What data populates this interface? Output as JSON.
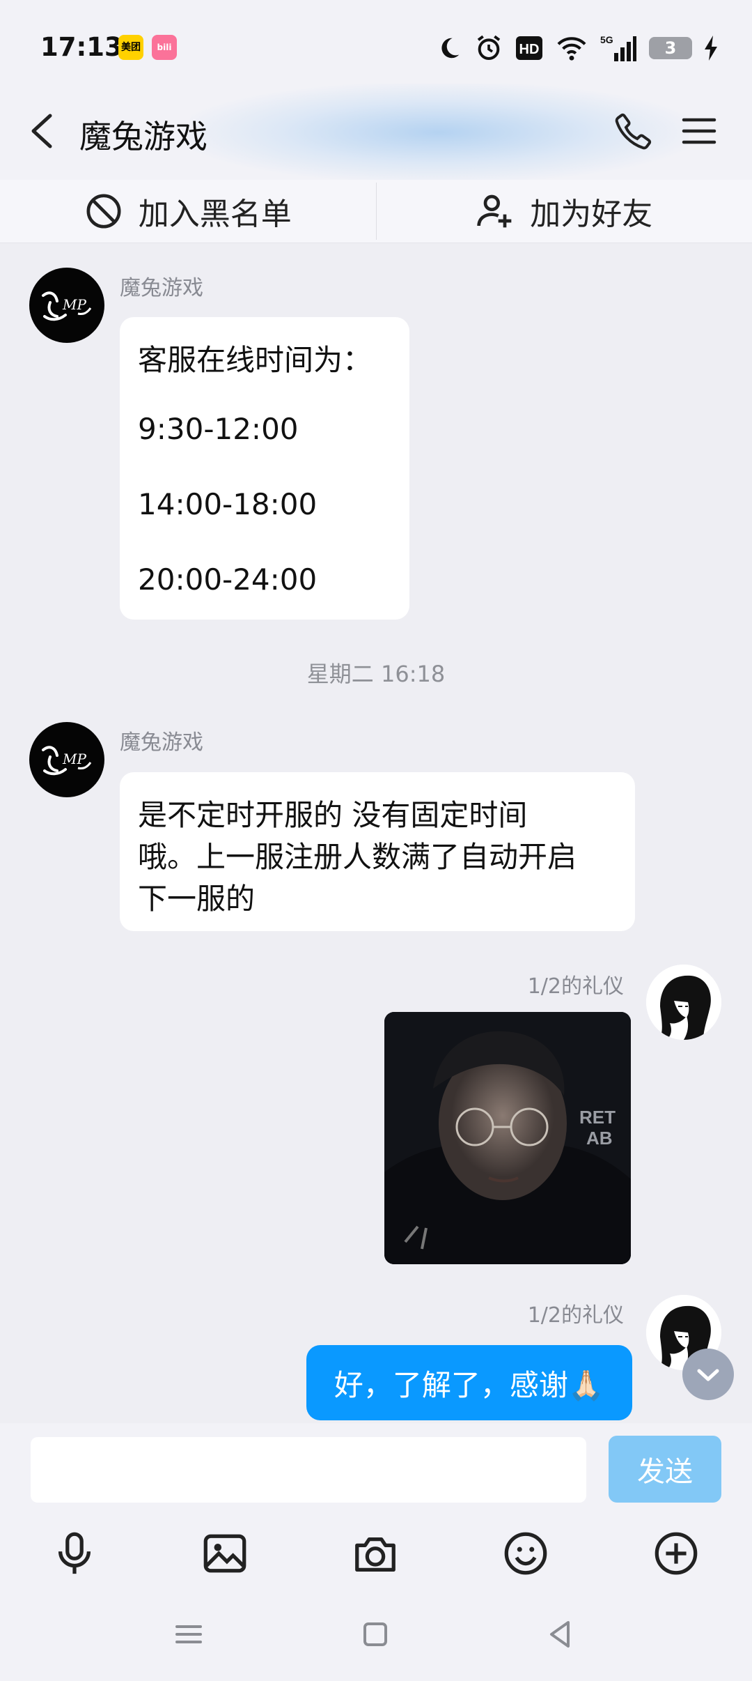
{
  "status_bar": {
    "time": "17:13",
    "app_badges": [
      {
        "label": "美团",
        "color": "#FFD100"
      },
      {
        "label": "bili",
        "color": "#FB7299"
      }
    ],
    "network": "5G",
    "battery": "3"
  },
  "header": {
    "title": "魔兔游戏",
    "icons": [
      "back-arrow-icon",
      "phone-icon",
      "menu-icon"
    ]
  },
  "actions": {
    "block_label": "加入黑名单",
    "add_friend_label": "加为好友"
  },
  "messages": {
    "msg1": {
      "sender": "魔兔游戏",
      "lines": [
        "客服在线时间为：",
        "9:30-12:00",
        "14:00-18:00",
        "20:00-24:00"
      ]
    },
    "time_separator": "星期二 16:18",
    "msg2": {
      "sender": "魔兔游戏",
      "lines": [
        "是不定时开服的  没有固定时间",
        "哦。上一服注册人数满了自动开启",
        "下一服的"
      ]
    },
    "msg3": {
      "sender": "1/2的礼仪",
      "type": "image"
    },
    "msg4": {
      "sender": "1/2的礼仪",
      "text": "好，了解了，感谢🙏🏻"
    }
  },
  "composer": {
    "input_value": "",
    "send_label": "发送",
    "tools": [
      "microphone-icon",
      "image-icon",
      "camera-icon",
      "emoji-icon",
      "plus-icon"
    ]
  },
  "colors": {
    "accent": "#0A99FF",
    "send_disabled": "#82C8F6",
    "background": "#EEEEF3"
  }
}
